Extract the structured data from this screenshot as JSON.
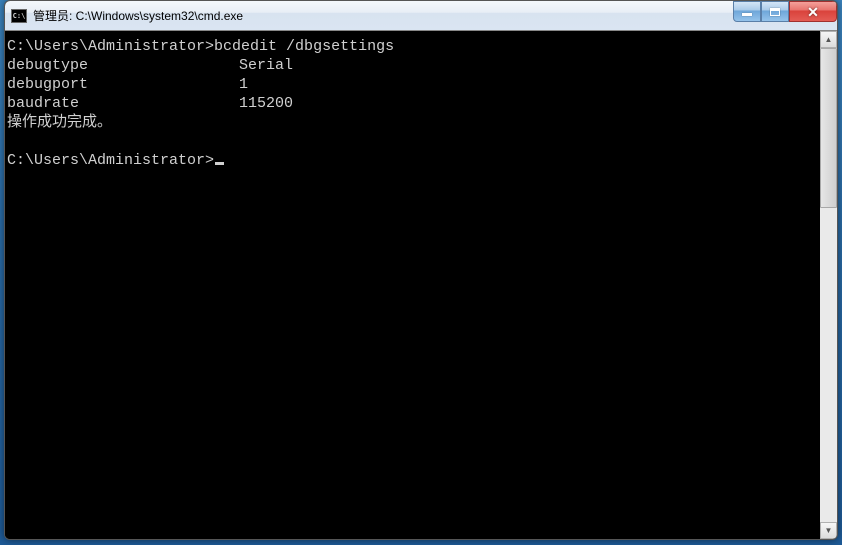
{
  "window": {
    "title": "管理员: C:\\Windows\\system32\\cmd.exe",
    "icon_label": "C:\\"
  },
  "console": {
    "prompt1": "C:\\Users\\Administrator>",
    "command1": "bcdedit /dbgsettings",
    "output": [
      {
        "key": "debugtype",
        "value": "Serial"
      },
      {
        "key": "debugport",
        "value": "1"
      },
      {
        "key": "baudrate",
        "value": "115200"
      }
    ],
    "success_msg": "操作成功完成。",
    "prompt2": "C:\\Users\\Administrator>"
  }
}
